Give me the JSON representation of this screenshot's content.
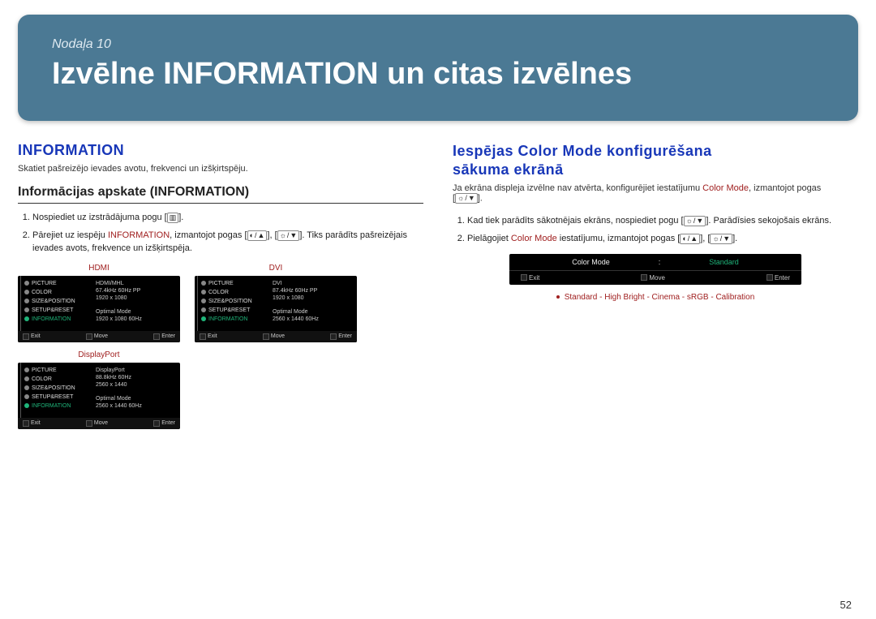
{
  "header": {
    "chapter": "Nodaļa 10",
    "title": "Izvēlne INFORMATION un citas izvēlnes"
  },
  "left": {
    "heading": "INFORMATION",
    "intro": "Skatiet pašreizējo ievades avotu, frekvenci un izšķirtspēju.",
    "subheading": "Informācijas apskate (INFORMATION)",
    "step1_a": "Nospiediet uz izstrādājuma pogu [",
    "step1_b": "].",
    "step2_a": "Pārejiet uz iespēju ",
    "step2_term": "INFORMATION",
    "step2_b": ", izmantojot pogas [",
    "step2_c": "], [",
    "step2_d": "]. Tiks parādīts pašreizējais ievades avots, frekvence un izšķirtspēja.",
    "icon_menu": "▥",
    "icon_up": "▲",
    "icon_down": "▼",
    "icon_sun": "☼",
    "icon_contrast": "◐",
    "foot_exit": "Exit",
    "foot_move": "Move",
    "foot_enter": "Enter",
    "osd": {
      "nav": [
        "PICTURE",
        "COLOR",
        "SIZE&POSITION",
        "SETUP&RESET",
        "INFORMATION"
      ],
      "rows": [
        {
          "label": "HDMI",
          "line1": "HDMI/MHL",
          "line2": "67.4kHz 60Hz PP",
          "line3": "1920 x 1080",
          "line4": "Optimal Mode",
          "line5": "1920 x 1080  60Hz"
        },
        {
          "label": "DVI",
          "line1": "DVI",
          "line2": "87.4kHz 60Hz PP",
          "line3": "1920 x 1080",
          "line4": "Optimal Mode",
          "line5": "2560 x 1440  60Hz"
        },
        {
          "label": "DisplayPort",
          "line1": "DisplayPort",
          "line2": "88.8kHz 60Hz",
          "line3": "2560 x 1440",
          "line4": "Optimal Mode",
          "line5": "2560 x 1440  60Hz"
        }
      ]
    }
  },
  "right": {
    "heading_a": "Iespējas Color Mode konfigurēšana",
    "heading_b": "sākuma ekrānā",
    "intro_a": "Ja ekrāna displeja izvēlne nav atvērta, konfigurējiet iestatījumu ",
    "intro_term": "Color Mode",
    "intro_b": ", izmantojot pogas",
    "intro_c": "[",
    "intro_d": "].",
    "step1_a": "Kad tiek parādīts sākotnējais ekrāns, nospiediet pogu [",
    "step1_b": "]. Parādīsies sekojošais ekrāns.",
    "step2_a": "Pielāgojiet ",
    "step2_term": "Color Mode",
    "step2_b": " iestatījumu, izmantojot pogas [",
    "step2_c": "], [",
    "step2_d": "].",
    "bar": {
      "label": "Color Mode",
      "value": "Standard",
      "exit": "Exit",
      "move": "Move",
      "enter": "Enter"
    },
    "options": "Standard - High Bright - Cinema - sRGB - Calibration"
  },
  "page_number": "52"
}
